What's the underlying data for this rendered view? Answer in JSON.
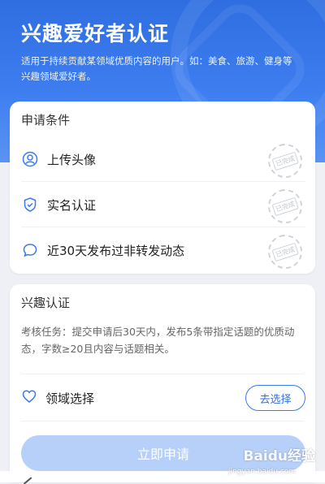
{
  "header": {
    "title": "兴趣爱好者认证",
    "description": "适用于持续贡献某领域优质内容的用户。如：美食、旅游、健身等兴趣领域爱好者。"
  },
  "conditions": {
    "title": "申请条件",
    "items": [
      {
        "label": "上传头像",
        "icon": "user-icon",
        "stamp": "已完成"
      },
      {
        "label": "实名认证",
        "icon": "shield-check-icon",
        "stamp": "已完成"
      },
      {
        "label": "近30天发布过非转发动态",
        "icon": "chat-bubble-icon",
        "stamp": "已完成"
      }
    ]
  },
  "interest": {
    "title": "兴趣认证",
    "task": "考核任务：提交申请后30天内，发布5条带指定话题的优质动态，字数≥20且内容与话题相关。",
    "domain_label": "领域选择",
    "choose_button": "去选择",
    "apply_button": "立即申请"
  },
  "watermark": {
    "brand": "Baidu经验",
    "site": "jingyan.baidu.com"
  },
  "colors": {
    "accent": "#2f6ee0",
    "apply_disabled": "#b7d0f9"
  }
}
